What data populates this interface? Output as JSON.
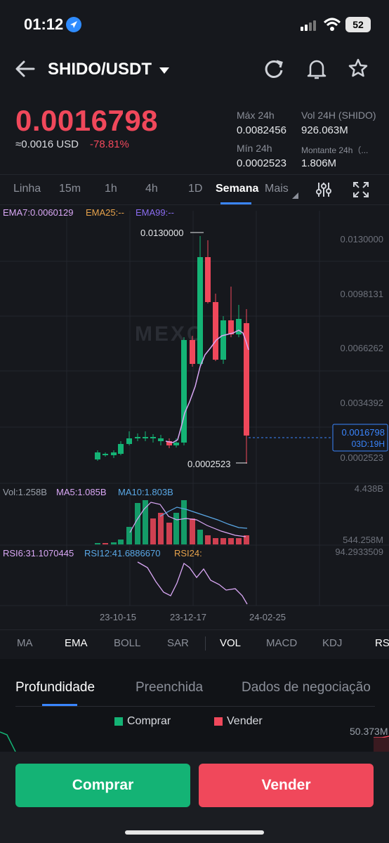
{
  "status": {
    "time": "01:12",
    "battery": "52"
  },
  "header": {
    "pair": "SHIDO/USDT"
  },
  "price": {
    "last": "0.0016798",
    "usd_approx": "≈0.0016",
    "usd_label": "USD",
    "change_pct": "-78.81%"
  },
  "stats": {
    "high_label": "Máx 24h",
    "high_value": "0.0082456",
    "vol_label": "Vol 24H (SHIDO)",
    "vol_value": "926.063M",
    "low_label": "Mín 24h",
    "low_value": "0.0002523",
    "amount_label": "Montante 24h（...",
    "amount_value": "1.806M"
  },
  "timeframes": [
    "Linha",
    "15m",
    "1h",
    "4h",
    "1D",
    "Semana",
    "Mais"
  ],
  "active_timeframe": "Semana",
  "chart": {
    "ema_legend": {
      "ema7": "EMA7:0.0060129",
      "ema25": "EMA25:--",
      "ema99": "EMA99:--"
    },
    "price_axis": [
      "0.0130000",
      "0.0098131",
      "0.0066262",
      "0.0034392",
      "0.0002523"
    ],
    "high_marker": "0.0130000",
    "low_marker": "0.0002523",
    "current_price_tag": "0.0016798",
    "countdown": "03D:19H",
    "watermark": "MEXC",
    "vol_legend": {
      "vol": "Vol:1.258B",
      "ma5": "MA5:1.085B",
      "ma10": "MA10:1.803B"
    },
    "vol_axis": [
      "4.438B",
      "544.258M"
    ],
    "rsi_legend": {
      "rsi6": "RSI6:31.1070445",
      "rsi12": "RSI12:41.6886670",
      "rsi24": "RSI24:"
    },
    "rsi_axis": "94.2933509",
    "dates": [
      "23-10-15",
      "23-12-17",
      "24-02-25"
    ],
    "colors": {
      "up": "#14b375",
      "down": "#f0485b",
      "ema7": "#d9a7f5",
      "ema25": "#e6a24b",
      "ema99": "#8a6cf0",
      "ma10": "#5aa8e6"
    }
  },
  "indicators": [
    "MA",
    "EMA",
    "BOLL",
    "SAR",
    "VOL",
    "MACD",
    "KDJ",
    "RS"
  ],
  "active_indicators": [
    "EMA",
    "VOL"
  ],
  "lower_tabs": [
    "Profundidade",
    "Preenchida",
    "Dados de negociação"
  ],
  "depth": {
    "buy_label": "Comprar",
    "sell_label": "Vender",
    "axis_value": "50.373M"
  },
  "actions": {
    "buy": "Comprar",
    "sell": "Vender"
  }
}
